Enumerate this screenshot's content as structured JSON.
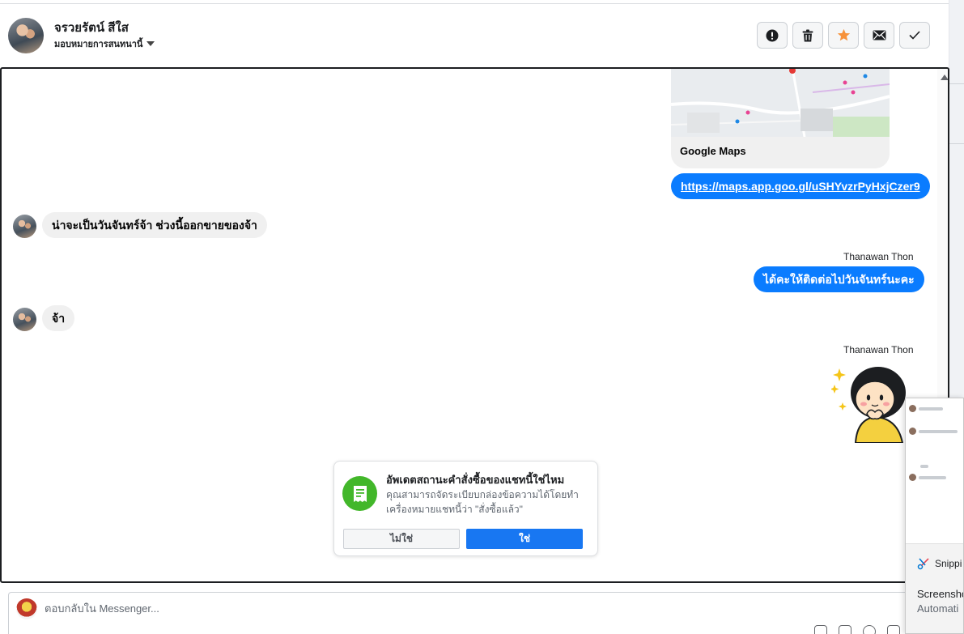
{
  "header": {
    "contact_name": "จรวยรัตน์ สีใส",
    "assign_label": "มอบหมายการสนทนานี้",
    "actions": [
      {
        "name": "mark-spam",
        "icon": "alert-icon"
      },
      {
        "name": "delete",
        "icon": "trash-icon"
      },
      {
        "name": "star",
        "icon": "star-icon"
      },
      {
        "name": "mark-unread",
        "icon": "envelope-icon"
      },
      {
        "name": "mark-done",
        "icon": "check-icon"
      }
    ]
  },
  "messages": {
    "map_card_title": "Google Maps",
    "map_link": "https://maps.app.goo.gl/uSHYvzrPyHxjCzer9",
    "msg1": "น่าจะเป็นวันจันทร์จ้า ช่วงนี้ออกขายของจ้า",
    "sender1": "Thanawan Thon",
    "msg2": "ได้คะให้ติดต่อไปวันจันทร์นะคะ",
    "msg3": "จ้า",
    "sender2": "Thanawan Thon"
  },
  "order_prompt": {
    "title": "อัพเดตสถานะคำสั่งซื้อของแชทนี้ใช่ไหม",
    "body": "คุณสามารถจัดระเบียบกล่องข้อความได้โดยทำเครื่องหมายแชทนี้ว่า \"สั่งซื้อแล้ว\"",
    "no_label": "ไม่ใช่",
    "yes_label": "ใช่"
  },
  "composer": {
    "placeholder": "ตอบกลับใน Messenger..."
  },
  "snip_overlay": {
    "app_name": "Snippi",
    "line1": "Screensho",
    "line2": "Automati"
  },
  "colors": {
    "messenger_blue": "#0a7cff",
    "primary_button": "#1877f2",
    "prompt_icon_green": "#42b72a",
    "star_orange": "#f7923a"
  }
}
